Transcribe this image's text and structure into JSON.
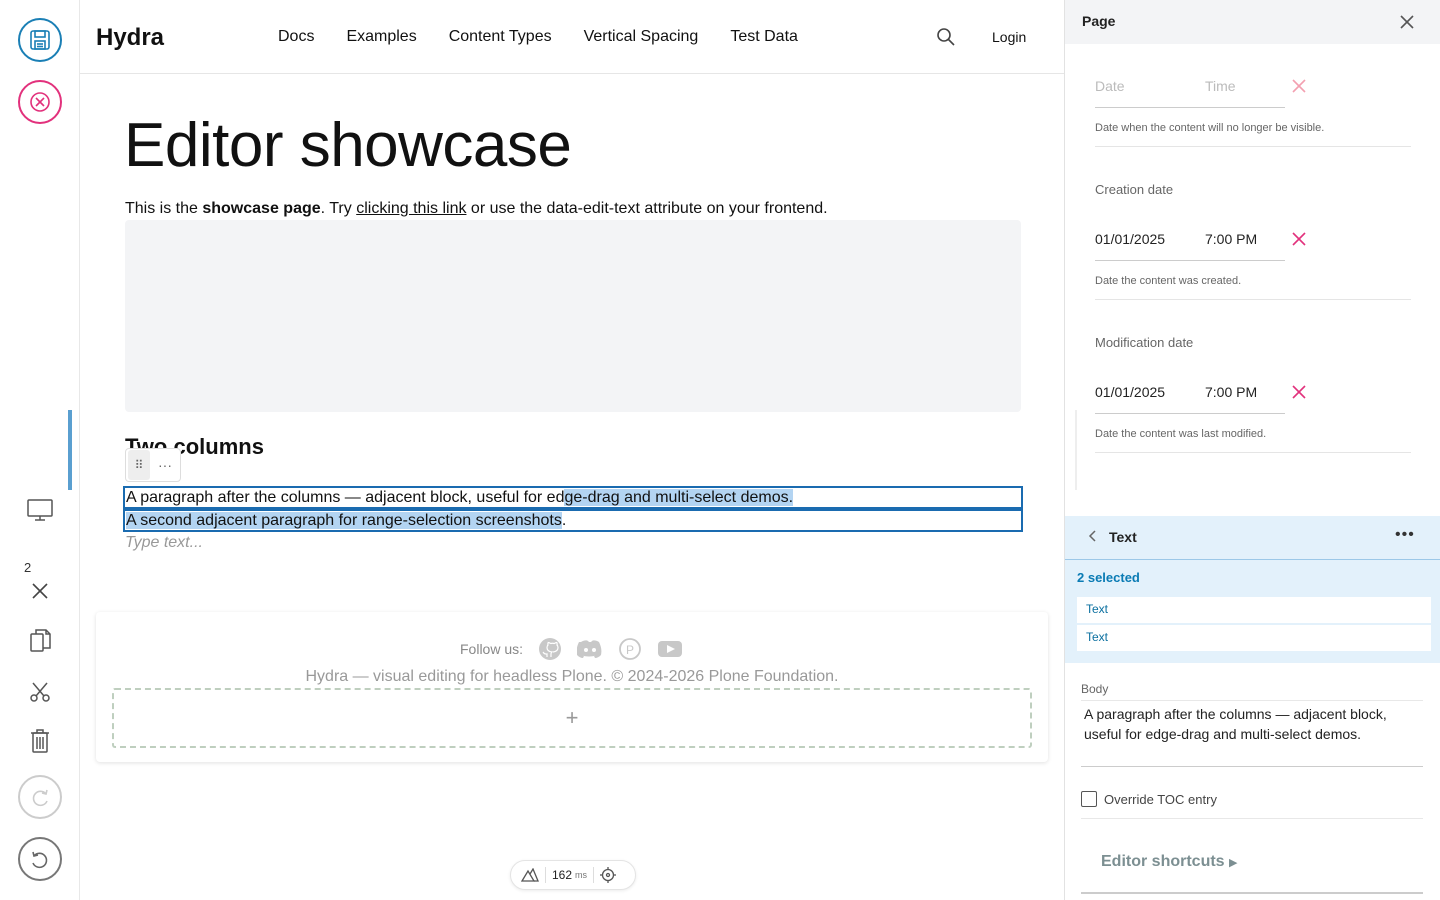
{
  "toolbar": {
    "selection_count": "2"
  },
  "header": {
    "logo": "Hydra",
    "nav": [
      "Docs",
      "Examples",
      "Content Types",
      "Vertical Spacing",
      "Test Data"
    ],
    "login": "Login"
  },
  "content": {
    "title": "Editor showcase",
    "intro_prefix": "This is the ",
    "intro_bold": "showcase page",
    "intro_mid": ". Try ",
    "intro_link": "clicking this link",
    "intro_suffix": " or use the data-edit-text attribute on your frontend.",
    "heading2": "Two columns",
    "para1_plain": "A paragraph after the columns — adjacent block, useful for ed",
    "para1_selected": "ge-drag and multi-select demos. ",
    "para2_selected": "A second adjacent paragraph for range-selection screenshots",
    "para2_plain": ".",
    "placeholder": "Type text..."
  },
  "footer": {
    "follow_label": "Follow us:",
    "social": [
      "github-icon",
      "discord-icon",
      "patreon-icon",
      "youtube-icon"
    ],
    "copyright": "Hydra — visual editing for headless Plone. © 2024-2026 Plone Foundation.",
    "add_label": "+"
  },
  "perf": {
    "value": "162",
    "unit": "ms"
  },
  "sidebar": {
    "title": "Page",
    "expiration": {
      "date_placeholder": "Date",
      "time_placeholder": "Time",
      "help": "Date when the content will no longer be visible."
    },
    "creation": {
      "label": "Creation date",
      "date": "01/01/2025",
      "time": "7:00 PM",
      "help": "Date the content was created."
    },
    "modification": {
      "label": "Modification date",
      "date": "01/01/2025",
      "time": "7:00 PM",
      "help": "Date the content was last modified."
    },
    "block": {
      "title": "Text",
      "selected_count": "2 selected",
      "items": [
        "Text",
        "Text"
      ],
      "body_label": "Body",
      "body_text": "A paragraph after the columns — adjacent block, useful for edge-drag and multi-select demos.",
      "toc_label": "Override TOC entry",
      "toc_checked": false,
      "shortcuts": "Editor shortcuts"
    }
  },
  "colors": {
    "save": "#1a7fb5",
    "cancel": "#e2317c",
    "selection": "#b3d4f2",
    "block_panel": "#e3f1fb",
    "accent": "#0a7bb4"
  }
}
